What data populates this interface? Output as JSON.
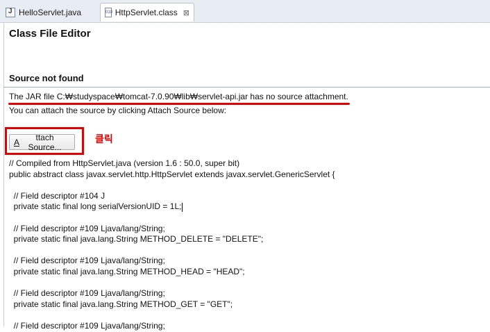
{
  "tabs": [
    {
      "label": "HelloServlet.java",
      "icon": "java-file-icon",
      "active": false
    },
    {
      "label": "HttpServlet.class",
      "icon": "class-file-icon",
      "active": true,
      "close": "⊠"
    }
  ],
  "editor": {
    "title": "Class File Editor",
    "source_heading": "Source not found",
    "jar_message": "The JAR file C:₩studyspace₩tomcat-7.0.90₩lib₩servlet-api.jar has no source attachment.",
    "attach_message": "You can attach the source by clicking Attach Source below:",
    "attach_button": {
      "mnemonic": "A",
      "rest": "ttach Source..."
    },
    "annotation_label": "클릭",
    "annotation_color": "#e30000"
  },
  "code_lines": [
    "// Compiled from HttpServlet.java (version 1.6 : 50.0, super bit)",
    "public abstract class javax.servlet.http.HttpServlet extends javax.servlet.GenericServlet {",
    "",
    "  // Field descriptor #104 J",
    "  private static final long serialVersionUID = 1L;",
    "",
    "  // Field descriptor #109 Ljava/lang/String;",
    "  private static final java.lang.String METHOD_DELETE = \"DELETE\";",
    "",
    "  // Field descriptor #109 Ljava/lang/String;",
    "  private static final java.lang.String METHOD_HEAD = \"HEAD\";",
    "",
    "  // Field descriptor #109 Ljava/lang/String;",
    "  private static final java.lang.String METHOD_GET = \"GET\";",
    "",
    "  // Field descriptor #109 Ljava/lang/String;"
  ]
}
